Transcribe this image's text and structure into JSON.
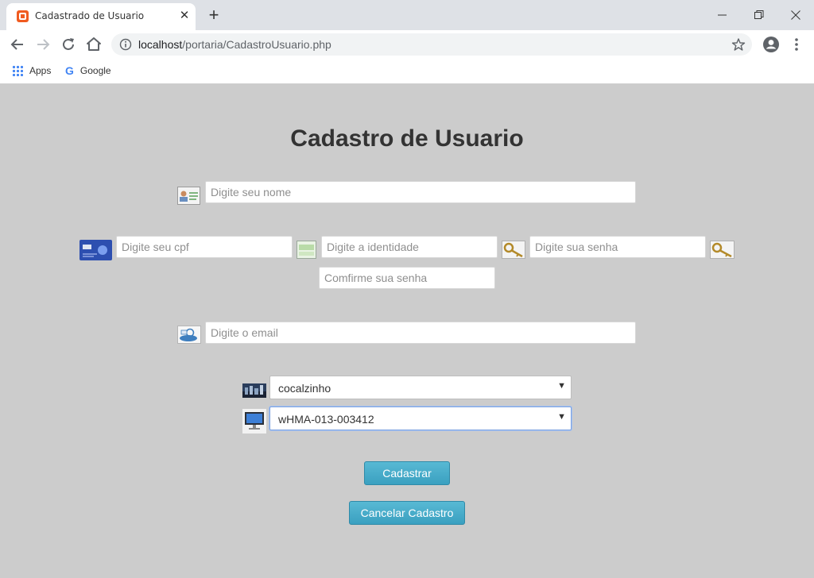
{
  "browser": {
    "tab_title": "Cadastrado de Usuario",
    "tab_close": "✕",
    "new_tab": "+",
    "url_host": "localhost",
    "url_path": "/portaria/CadastroUsuario.php",
    "bookmarks": [
      {
        "label": "Apps",
        "icon": "apps-grid-icon"
      },
      {
        "label": "Google",
        "icon": "google-icon"
      }
    ],
    "google_glyph": "G"
  },
  "form": {
    "title": "Cadastro de Usuario",
    "nome_placeholder": "Digite seu nome",
    "cpf_placeholder": "Digite seu cpf",
    "identidade_placeholder": "Digite a identidade",
    "senha_placeholder": "Digite sua senha",
    "confirma_placeholder": "Comfirme sua senha",
    "email_placeholder": "Digite o email",
    "local_select": {
      "value": "cocalzinho"
    },
    "maquina_select": {
      "value": "wHMA-013-003412"
    },
    "select_arrow": "▼",
    "cadastrar_label": "Cadastrar",
    "cancelar_label": "Cancelar Cadastro"
  },
  "colors": {
    "background": "#cccccc",
    "button": "#3aa0c0",
    "title": "#333333"
  }
}
